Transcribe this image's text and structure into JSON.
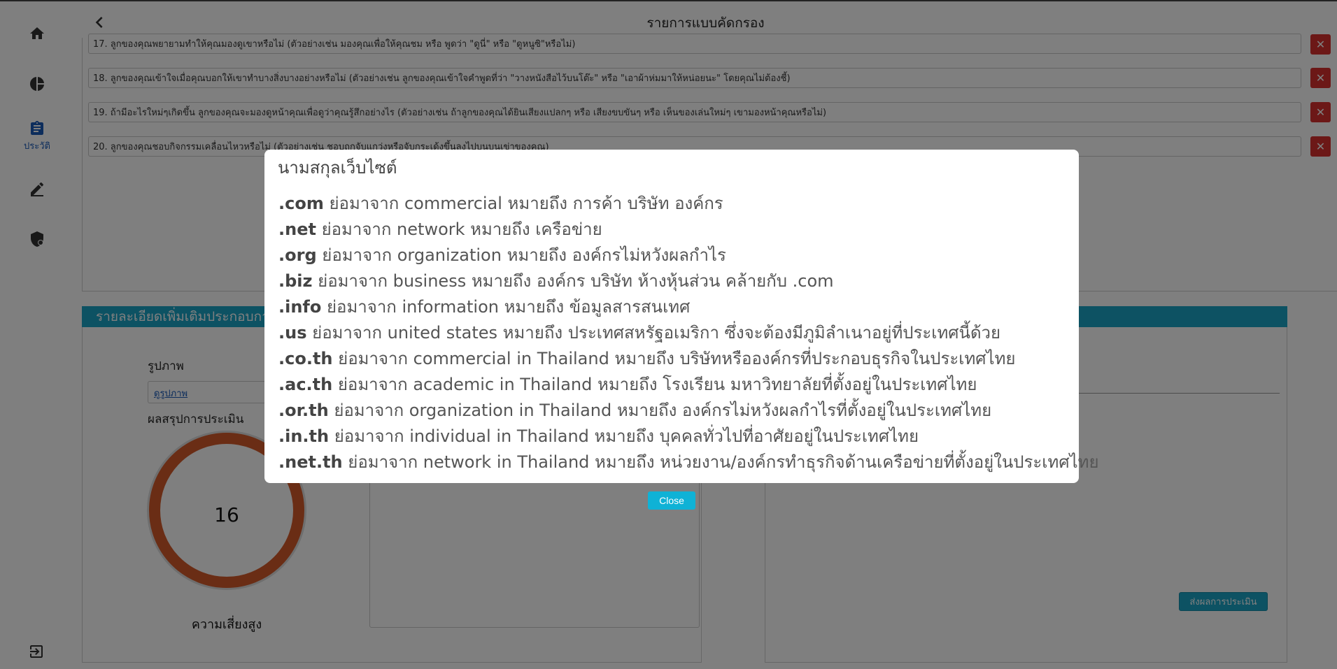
{
  "header": {
    "title": "รายการแบบคัดกรอง"
  },
  "sidebar": {
    "items": [
      {
        "icon": "home-icon",
        "label": ""
      },
      {
        "icon": "pie-chart-icon",
        "label": ""
      },
      {
        "icon": "clipboard-icon",
        "label": "ประวัติ"
      },
      {
        "icon": "pen-icon",
        "label": ""
      },
      {
        "icon": "shield-icon",
        "label": ""
      }
    ],
    "logout_icon": "logout-icon",
    "active_color": "#1a5bb8"
  },
  "questions": [
    "17. ลูกของคุณพยายามทำให้คุณมองดูเขาหรือไม่ (ตัวอย่างเช่น มองคุณเพื่อให้คุณชม หรือ พูดว่า \"ดูนี่\" หรือ \"ดูหนูซิ\"หรือไม่)",
    "18. ลูกของคุณเข้าใจเมื่อคุณบอกให้เขาทำบางสิ่งบางอย่างหรือไม่ (ตัวอย่างเช่น ลูกของคุณเข้าใจคำพูดที่ว่า \"วางหนังสือไว้บนโต๊ะ\" หรือ \"เอาผ้าห่มมาให้หน่อยนะ\" โดยคุณไม่ต้องชี้)",
    "19. ถ้ามีอะไรใหม่ๆเกิดขึ้น ลูกของคุณจะมองดูหน้าคุณเพื่อดูว่าคุณรู้สึกอย่างไร (ตัวอย่างเช่น ถ้าลูกของคุณได้ยินเสียงแปลกๆ หรือ เสียงขบขันๆ หรือ เห็นของเล่นใหม่ๆ เขามองหน้าคุณหรือไม่)",
    "20. ลูกของคุณชอบกิจกรรมเคลื่อนไหวหรือไม่ (ตัวอย่างเช่น ชอบถูกจับแกว่งหรือจับกระเด้งขึ้นลงไปบนบนเข่าของคุณ)"
  ],
  "detail": {
    "heading": "รายละเอียดเพิ่มเติมประกอบการ",
    "image_label": "รูปภาพ",
    "image_link": "ดูรูปภาพ",
    "summary_label": "ผลสรุปการประเมิน",
    "score": "16",
    "risk": "ความเสี่ยงสูง",
    "risk_level": 0.75,
    "submit_button": "ส่งผลการประเมิน",
    "accent_color": "#1ba5c7",
    "ring_color": "#d45a2a"
  },
  "modal": {
    "title": "นามสกุลเว็บไซต์",
    "items": [
      {
        "code": ".com",
        "text": " ย่อมาจาก commercial หมายถึง การค้า บริษัท องค์กร"
      },
      {
        "code": ".net",
        "text": " ย่อมาจาก network หมายถึง เครือข่าย"
      },
      {
        "code": ".org",
        "text": " ย่อมาจาก organization หมายถึง องค์กรไม่หวังผลกำไร"
      },
      {
        "code": ".biz",
        "text": " ย่อมาจาก business หมายถึง องค์กร บริษัท ห้างหุ้นส่วน คล้ายกับ .com"
      },
      {
        "code": ".info",
        "text": " ย่อมาจาก information หมายถึง ข้อมูลสารสนเทศ"
      },
      {
        "code": ".us",
        "text": " ย่อมาจาก united states หมายถึง ประเทศสหรัฐอเมริกา ซึ่งจะต้องมีภูมิลำเนาอยู่ที่ประเทศนี้ด้วย"
      },
      {
        "code": ".co.th",
        "text": " ย่อมาจาก commercial in Thailand หมายถึง บริษัทหรือองค์กรที่ประกอบธุรกิจในประเทศไทย"
      },
      {
        "code": ".ac.th",
        "text": " ย่อมาจาก academic in Thailand หมายถึง โรงเรียน มหาวิทยาลัยที่ตั้งอยู่ในประเทศไทย"
      },
      {
        "code": ".or.th",
        "text": " ย่อมาจาก organization in Thailand หมายถึง องค์กรไม่หวังผลกำไรที่ตั้งอยู่ในประเทศไทย"
      },
      {
        "code": ".in.th",
        "text": " ย่อมาจาก individual in Thailand หมายถึง บุคคลทั่วไปที่อาศัยอยู่ในประเทศไทย"
      },
      {
        "code": ".net.th",
        "text": " ย่อมาจาก network in Thailand หมายถึง หน่วยงาน/องค์กรทำธุรกิจด้านเครือข่ายที่ตั้งอยู่ในประเทศไทย"
      }
    ],
    "close_button": "Close",
    "close_color": "#0fb2d6"
  }
}
